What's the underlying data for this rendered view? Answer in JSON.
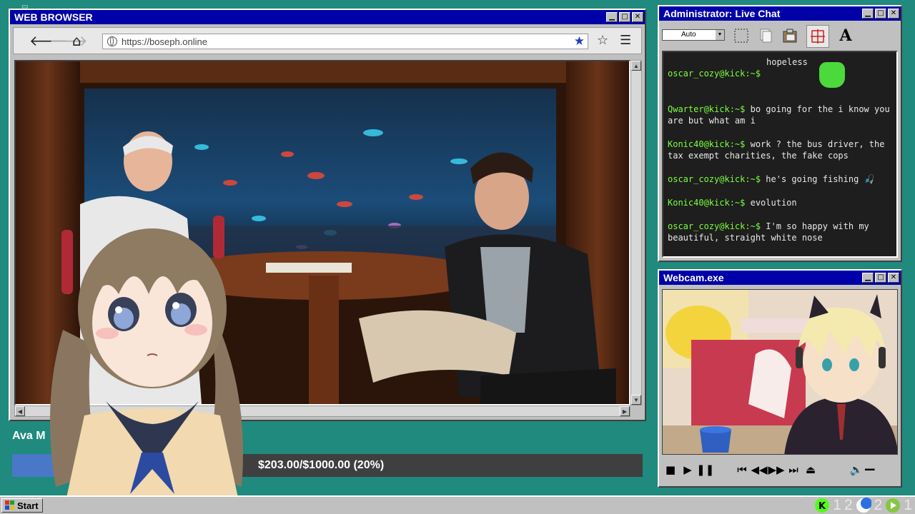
{
  "browser": {
    "title": "WEB BROWSER",
    "url": "https://boseph.online"
  },
  "chat": {
    "title": "Administrator: Live Chat",
    "zoom_select": "Auto",
    "partial_text": "hopeless",
    "messages": [
      {
        "user": "oscar_cozy@kick:~$",
        "text": ""
      },
      {
        "user": "Qwarter@kick:~$",
        "text": "bo going for the i know you are but what am i"
      },
      {
        "user": "Konic40@kick:~$",
        "text": "work ? the bus driver, the tax exempt charities, the fake cops"
      },
      {
        "user": "oscar_cozy@kick:~$",
        "text": "he's going fishing"
      },
      {
        "user": "Konic40@kick:~$",
        "text": "evolution"
      },
      {
        "user": "oscar_cozy@kick:~$",
        "text": "I'm so happy with my beautiful, straight white nose"
      }
    ]
  },
  "webcam": {
    "title": "Webcam.exe"
  },
  "donation": {
    "name_partial": "Ava M",
    "text": "$203.00/$1000.00 (20%)",
    "progress": 0.203
  },
  "taskbar": {
    "start_label": "Start",
    "tray_counts": [
      "1",
      "2",
      "2",
      "1"
    ]
  },
  "colors": {
    "desktop": "#1f8a7d",
    "titlebar": "#0000a8",
    "chat_user": "#7cff3c",
    "progress_fill": "#4a78c8"
  }
}
